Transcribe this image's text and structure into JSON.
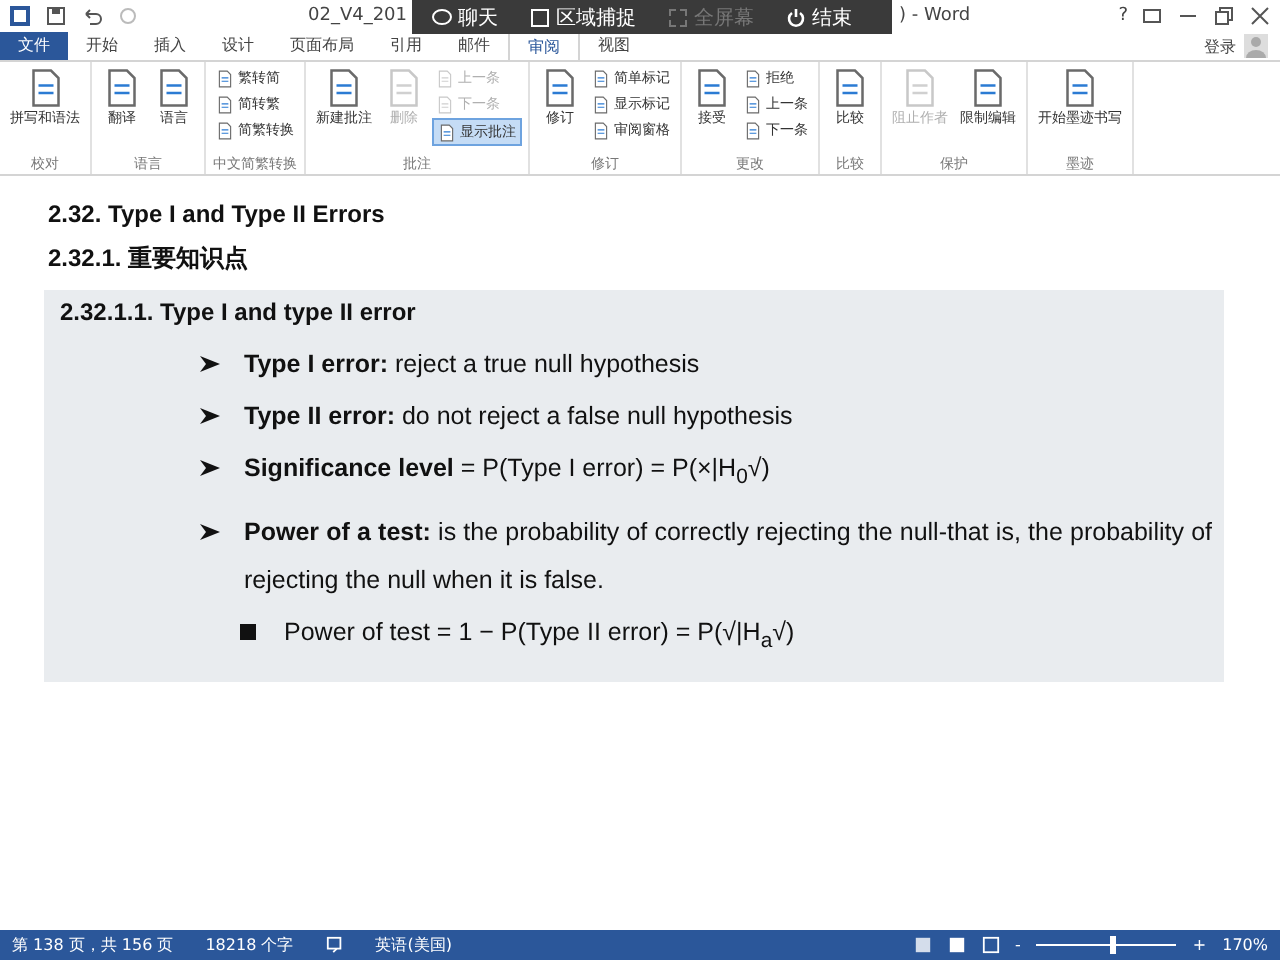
{
  "window": {
    "title_start": "02_V4_201",
    "title_end": ") - Word",
    "help": "?"
  },
  "recorder": [
    {
      "label": "聊天",
      "kind": "chat",
      "disabled": false
    },
    {
      "label": "区域捕捉",
      "kind": "region",
      "disabled": false
    },
    {
      "label": "全屏幕",
      "kind": "fullscreen",
      "disabled": true
    },
    {
      "label": "结束",
      "kind": "power",
      "disabled": false
    }
  ],
  "tabs": [
    {
      "label": "文件",
      "kind": "file",
      "selected": false
    },
    {
      "label": "开始",
      "kind": "tab",
      "selected": false
    },
    {
      "label": "插入",
      "kind": "tab",
      "selected": false
    },
    {
      "label": "设计",
      "kind": "tab",
      "selected": false
    },
    {
      "label": "页面布局",
      "kind": "tab",
      "selected": false
    },
    {
      "label": "引用",
      "kind": "tab",
      "selected": false
    },
    {
      "label": "邮件",
      "kind": "tab",
      "selected": false
    },
    {
      "label": "审阅",
      "kind": "tab",
      "selected": true
    },
    {
      "label": "视图",
      "kind": "tab",
      "selected": false
    }
  ],
  "account": {
    "label": "登录"
  },
  "ribbon": [
    {
      "label": "校对",
      "buttons": [
        {
          "label": "拼写和语法",
          "kind": "large",
          "disabled": false,
          "selected": false
        }
      ]
    },
    {
      "label": "语言",
      "buttons": [
        {
          "label": "翻译",
          "kind": "large",
          "disabled": false,
          "selected": false
        },
        {
          "label": "语言",
          "kind": "large",
          "disabled": false,
          "selected": false
        }
      ]
    },
    {
      "label": "中文简繁转换",
      "buttons": [
        {
          "label": "繁转简",
          "kind": "small",
          "disabled": false,
          "selected": false
        },
        {
          "label": "简转繁",
          "kind": "small",
          "disabled": false,
          "selected": false
        },
        {
          "label": "简繁转换",
          "kind": "small",
          "disabled": false,
          "selected": false
        }
      ]
    },
    {
      "label": "批注",
      "buttons": [
        {
          "label": "新建批注",
          "kind": "large",
          "disabled": false,
          "selected": false
        },
        {
          "label": "删除",
          "kind": "large",
          "disabled": true,
          "selected": false
        },
        {
          "label": "上一条",
          "kind": "small",
          "disabled": true,
          "selected": false
        },
        {
          "label": "下一条",
          "kind": "small",
          "disabled": true,
          "selected": false
        },
        {
          "label": "显示批注",
          "kind": "small",
          "disabled": false,
          "selected": true
        }
      ]
    },
    {
      "label": "修订",
      "buttons": [
        {
          "label": "修订",
          "kind": "large",
          "disabled": false,
          "selected": false
        },
        {
          "label": "简单标记",
          "kind": "small",
          "disabled": false,
          "selected": false
        },
        {
          "label": "显示标记",
          "kind": "small",
          "disabled": false,
          "selected": false
        },
        {
          "label": "审阅窗格",
          "kind": "small",
          "disabled": false,
          "selected": false
        }
      ]
    },
    {
      "label": "更改",
      "buttons": [
        {
          "label": "接受",
          "kind": "large",
          "disabled": false,
          "selected": false
        },
        {
          "label": "拒绝",
          "kind": "small",
          "disabled": false,
          "selected": false
        },
        {
          "label": "上一条",
          "kind": "small",
          "disabled": false,
          "selected": false
        },
        {
          "label": "下一条",
          "kind": "small",
          "disabled": false,
          "selected": false
        }
      ]
    },
    {
      "label": "比较",
      "buttons": [
        {
          "label": "比较",
          "kind": "large",
          "disabled": false,
          "selected": false
        }
      ]
    },
    {
      "label": "保护",
      "buttons": [
        {
          "label": "阻止作者",
          "kind": "large",
          "disabled": true,
          "selected": false
        },
        {
          "label": "限制编辑",
          "kind": "large",
          "disabled": false,
          "selected": false
        }
      ]
    },
    {
      "label": "墨迹",
      "buttons": [
        {
          "label": "开始墨迹书写",
          "kind": "large",
          "disabled": false,
          "selected": false
        }
      ]
    }
  ],
  "document": {
    "headings": [
      "2.32.  Type I and Type II Errors",
      "2.32.1.  重要知识点"
    ],
    "box_heading": "2.32.1.1.  Type I and type II error",
    "items": [
      {
        "kind": "arrow",
        "text": "**Type I error:** reject a true null hypothesis"
      },
      {
        "kind": "arrow",
        "text": "**Type II error:** do not reject a false null hypothesis"
      },
      {
        "kind": "arrow",
        "text": "**Significance level** = P(Type I error) = P(×|H$_{0}$√)"
      },
      {
        "kind": "arrow",
        "text": "**Power of a test:** is the probability of correctly rejecting the null-that is, the probability of rejecting the null when it is false."
      },
      {
        "kind": "square",
        "text": "Power of test = 1 − P(Type II error) = P(√|H$_{a}$√)"
      }
    ]
  },
  "status_bar": {
    "page": "第 138 页，共 156 页",
    "words": "18218 个字",
    "language": "英语(美国)",
    "zoom": {
      "level": 0.52,
      "minus": "-",
      "plus": "+",
      "reading": "170%"
    }
  }
}
